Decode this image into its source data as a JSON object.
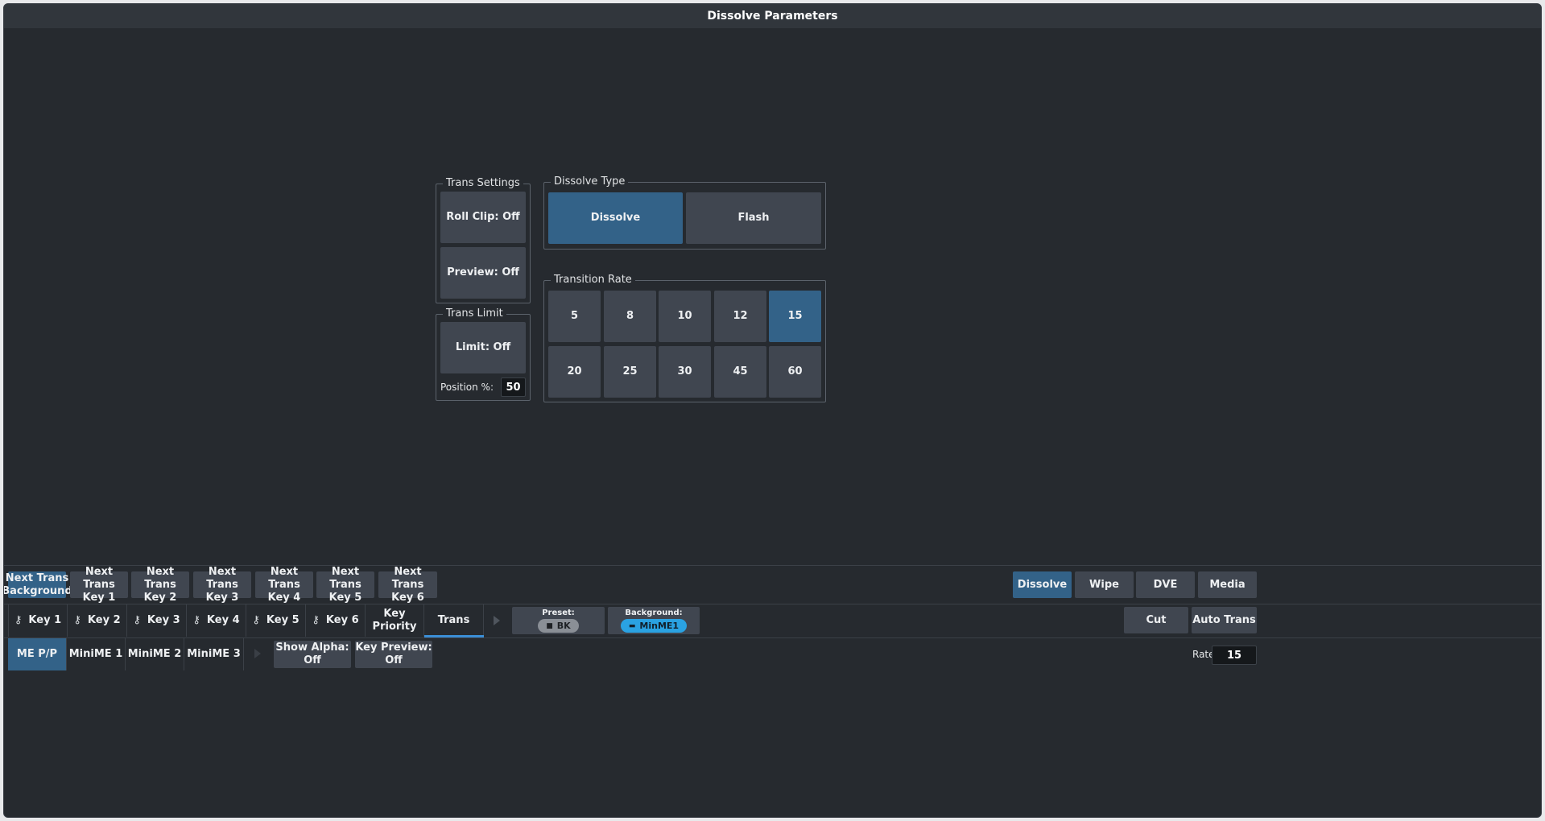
{
  "window": {
    "title": "Dissolve Parameters"
  },
  "trans_settings": {
    "label": "Trans Settings",
    "roll_clip": "Roll Clip: Off",
    "preview": "Preview: Off"
  },
  "trans_limit": {
    "label": "Trans Limit",
    "limit": "Limit: Off",
    "position_label": "Position %:",
    "position_value": "50"
  },
  "dissolve_type": {
    "label": "Dissolve Type",
    "options": [
      "Dissolve",
      "Flash"
    ],
    "selected": "Dissolve"
  },
  "transition_rate": {
    "label": "Transition Rate",
    "values": [
      "5",
      "8",
      "10",
      "12",
      "15",
      "20",
      "25",
      "30",
      "45",
      "60"
    ],
    "selected": "15"
  },
  "next_trans": {
    "buttons": [
      {
        "line1": "Next Trans",
        "line2": "Background",
        "selected": true
      },
      {
        "line1": "Next Trans",
        "line2": "Key 1",
        "selected": false
      },
      {
        "line1": "Next Trans",
        "line2": "Key 2",
        "selected": false
      },
      {
        "line1": "Next Trans",
        "line2": "Key 3",
        "selected": false
      },
      {
        "line1": "Next Trans",
        "line2": "Key 4",
        "selected": false
      },
      {
        "line1": "Next Trans",
        "line2": "Key 5",
        "selected": false
      },
      {
        "line1": "Next Trans",
        "line2": "Key 6",
        "selected": false
      }
    ]
  },
  "trans_types": {
    "buttons": [
      "Dissolve",
      "Wipe",
      "DVE",
      "Media"
    ],
    "selected": "Dissolve"
  },
  "key_tabs": {
    "items": [
      "Key 1",
      "Key 2",
      "Key 3",
      "Key 4",
      "Key 5",
      "Key 6"
    ],
    "key_priority_line1": "Key",
    "key_priority_line2": "Priority",
    "trans": "Trans",
    "icon": "key-icon"
  },
  "preset": {
    "label": "Preset:",
    "value": "BK"
  },
  "background": {
    "label": "Background:",
    "value": "MinME1"
  },
  "actions": {
    "cut": "Cut",
    "auto_trans": "Auto Trans"
  },
  "me_tabs": {
    "items": [
      "ME P/P",
      "MiniME 1",
      "MiniME 2",
      "MiniME 3"
    ],
    "selected": "ME P/P"
  },
  "show_alpha": {
    "line1": "Show Alpha:",
    "line2": "Off"
  },
  "key_preview": {
    "line1": "Key Preview:",
    "line2": "Off"
  },
  "rate": {
    "label": "Rate",
    "value": "15"
  },
  "colors": {
    "accent": "#336288",
    "button": "#404650",
    "background": "#262a2f",
    "underline": "#3b8ed6"
  }
}
